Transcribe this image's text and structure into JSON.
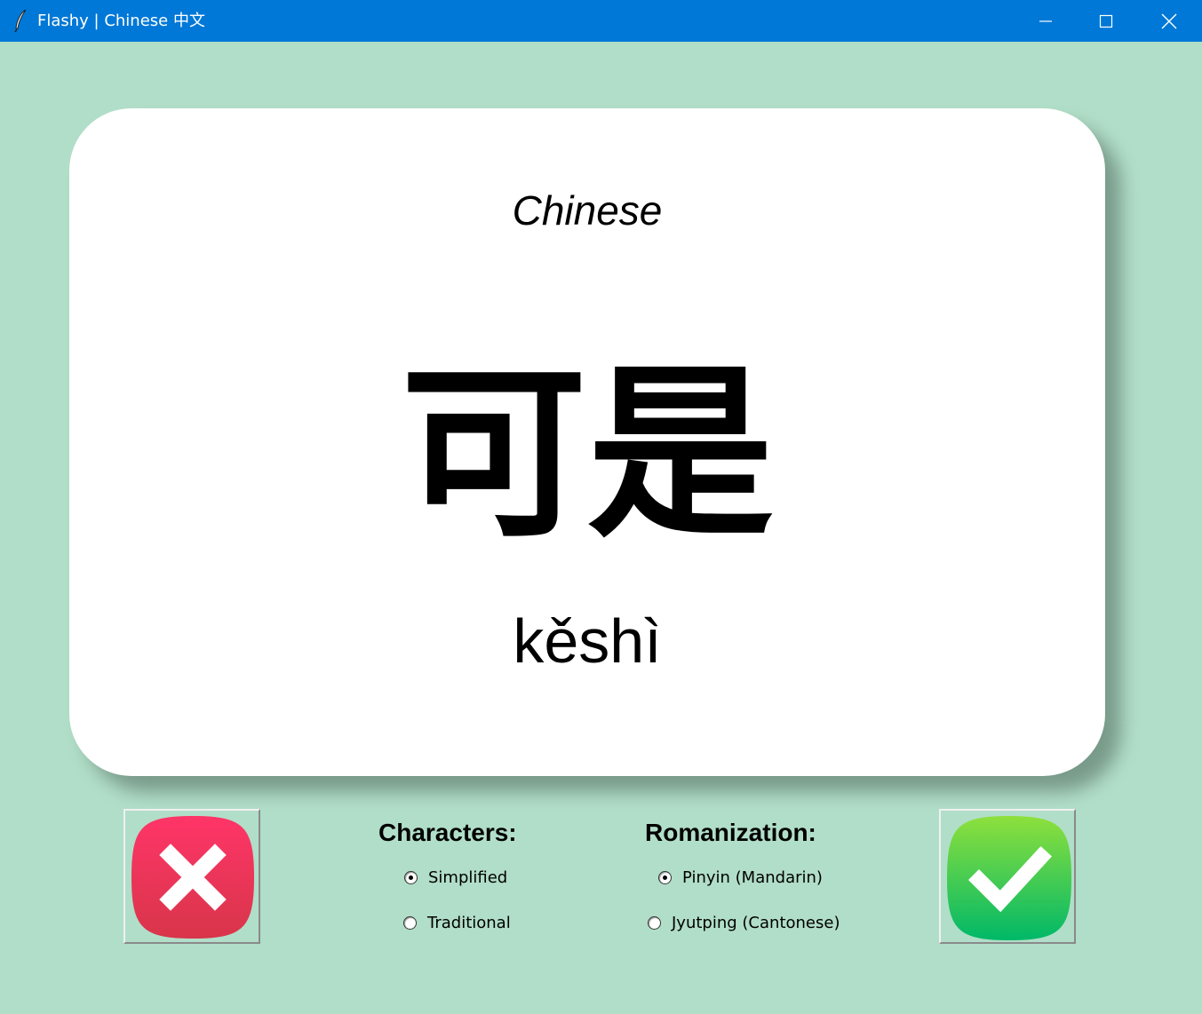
{
  "window": {
    "title": "Flashy | Chinese 中文",
    "icon": "feather-icon",
    "controls": [
      "minimize-icon",
      "maximize-icon",
      "close-icon"
    ]
  },
  "card": {
    "language": "Chinese",
    "word": "可是",
    "romanization": "kěshì"
  },
  "buttons": {
    "wrong": {
      "icon": "x-mark-icon",
      "color": "#e8345a"
    },
    "right": {
      "icon": "checkmark-icon",
      "color": "#22c25a"
    }
  },
  "characters": {
    "label": "Characters:",
    "options": [
      {
        "label": "Simplified",
        "selected": true
      },
      {
        "label": "Traditional",
        "selected": false
      }
    ]
  },
  "romanization": {
    "label": "Romanization:",
    "options": [
      {
        "label": "Pinyin (Mandarin)",
        "selected": true
      },
      {
        "label": "Jyutping (Cantonese)",
        "selected": false
      }
    ]
  },
  "colors": {
    "background": "#b1dec8",
    "titlebar": "#0078d7",
    "card": "#ffffff"
  }
}
